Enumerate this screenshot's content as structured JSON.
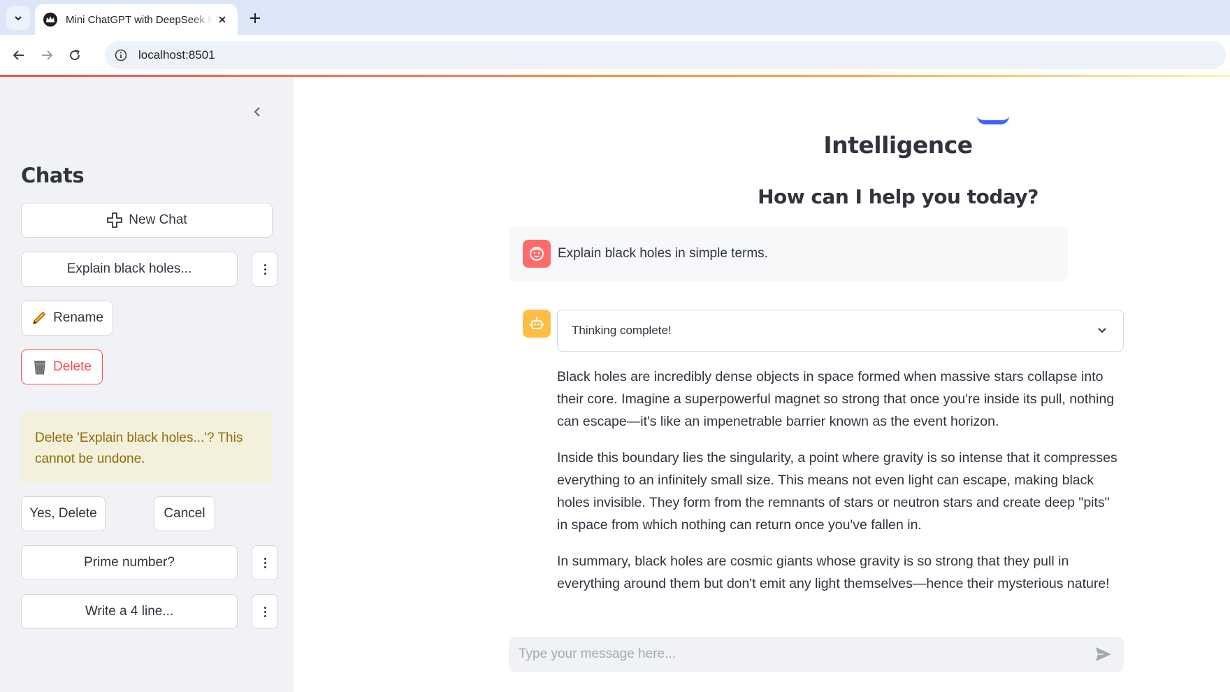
{
  "browser": {
    "tab_title": "Mini ChatGPT with DeepSeek Intelligence",
    "url": "localhost:8501"
  },
  "sidebar": {
    "title": "Chats",
    "new_chat_label": "New Chat",
    "chats": [
      {
        "label": "Explain black holes..."
      },
      {
        "label": "Prime number?"
      },
      {
        "label": "Write a 4 line..."
      }
    ],
    "rename_label": "Rename",
    "delete_label": "Delete",
    "confirm_text": "Delete 'Explain black holes...'? This cannot be undone.",
    "yes_delete_label": "Yes, Delete",
    "cancel_label": "Cancel"
  },
  "main": {
    "title": "Intelligence",
    "subtitle": "How can I help you today?",
    "user_message": "Explain black holes in simple terms.",
    "thinking_label": "Thinking complete!",
    "answer": [
      "Black holes are incredibly dense objects in space formed when massive stars collapse into their core. Imagine a superpowerful magnet so strong that once you're inside its pull, nothing can escape—it's like an impenetrable barrier known as the event horizon.",
      "Inside this boundary lies the singularity, a point where gravity is so intense that it compresses everything to an infinitely small size. This means not even light can escape, making black holes invisible. They form from the remnants of stars or neutron stars and create deep \"pits\" in space from which nothing can return once you've fallen in.",
      "In summary, black holes are cosmic giants whose gravity is so strong that they pull in everything around them but don't emit any light themselves—hence their mysterious nature!"
    ],
    "input_placeholder": "Type your message here..."
  },
  "colors": {
    "sidebar_bg": "#f0f2f6",
    "danger": "#ff4b4b",
    "warning_bg": "#f3f0dc",
    "warning_text": "#926c05",
    "user_avatar": "#ff6b6b",
    "bot_avatar": "#ffbd45"
  }
}
